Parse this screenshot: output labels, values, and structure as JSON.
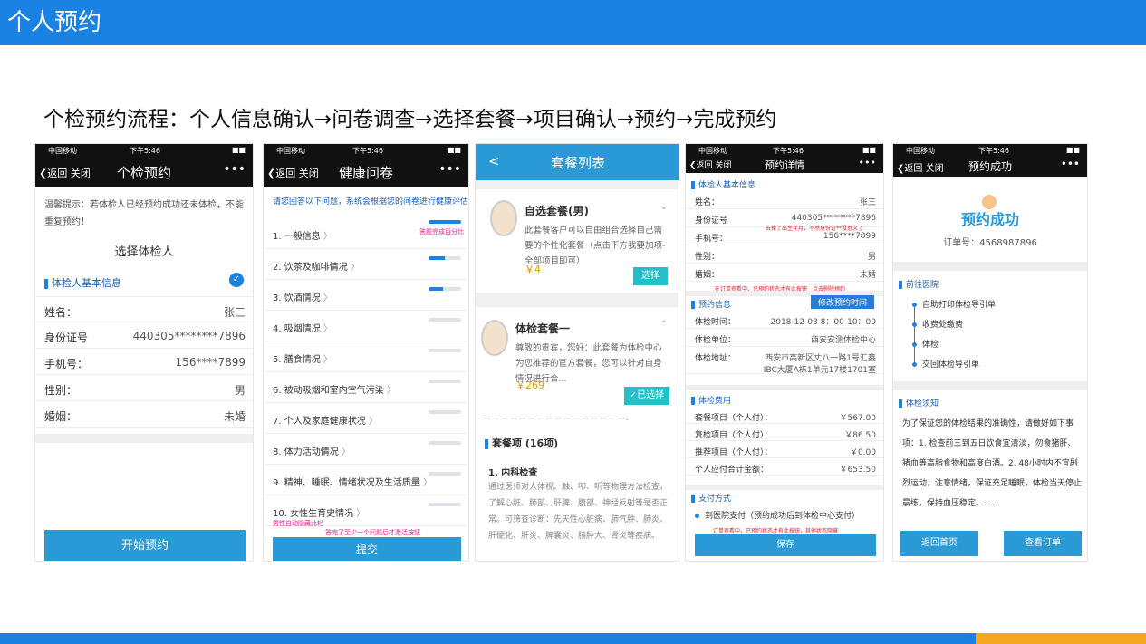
{
  "header": {
    "title": "个人预约"
  },
  "subtitle": "个检预约流程：个人信息确认→问卷调查→选择套餐→项目确认→预约→完成预约",
  "status": {
    "carrier": "中国移动",
    "time": "下午5:46",
    "battery": "■■"
  },
  "nav": {
    "back": "返回",
    "close": "关闭",
    "more": "•••"
  },
  "s1": {
    "title": "个检预约",
    "notice": "温馨提示：若体检人已经预约成功还未体检，不能重复预约！",
    "select": "选择体检人",
    "section": "体检人基本信息",
    "rows": [
      {
        "l": "姓名：",
        "r": "张三"
      },
      {
        "l": "身份证号",
        "r": "440305********7896"
      },
      {
        "l": "手机号：",
        "r": "156****7899"
      },
      {
        "l": "性别：",
        "r": "男"
      },
      {
        "l": "婚姻：",
        "r": "未婚"
      }
    ],
    "button": "开始预约"
  },
  "s2": {
    "title": "健康问卷",
    "hint": "请您回答以下问题，系统会根据您的问卷进行健康评估",
    "progress_note": "答题完成百分比",
    "items": [
      "1. 一般信息",
      "2. 饮茶及咖啡情况",
      "3. 饮酒情况",
      "4. 吸烟情况",
      "5. 膳食情况",
      "6. 被动吸烟和室内空气污染",
      "7. 个人及家庭健康状况",
      "8. 体力活动情况",
      "9. 精神、睡眠、情绪状况及生活质量",
      "10. 女性生育史情况"
    ],
    "progress": [
      1,
      0.5,
      0.45,
      0,
      0,
      0,
      0,
      0,
      0,
      0
    ],
    "note1": "男性自动隐藏此栏",
    "note2": "答完了至少一个问题后才激活按钮",
    "button": "提交"
  },
  "s3": {
    "title": "套餐列表",
    "back": "<",
    "pkg1": {
      "name": "自选套餐(男)",
      "desc": "此套餐客户可以自由组合选择自己需要的个性化套餐（点击下方我要加项-全部项目即可）",
      "price": "￥4",
      "btn": "选择"
    },
    "pkg2": {
      "name": "体检套餐一",
      "desc": "尊敬的贵宾，您好：此套餐为体检中心为您推荐的官方套餐，您可以针对自身情况进行合...",
      "price": "￥269",
      "btn": "✓已选择"
    },
    "dashes": "— — — — — — — — — — — — — — — — .",
    "items_title": "套餐项 (16项)",
    "item1_title": "1. 内科检查",
    "item1_desc": "通过医师对人体视、触、叩、听等物理方法检查，了解心脏、肺部、肝脾、腹部、神经反射等是否正常。可筛查诊断：先天性心脏病、肺气肿、肺炎、肝硬化、肝炎、脾囊炎、胰肿大、肾炎等疾病。"
  },
  "s4": {
    "title": "预约详情",
    "sec1": "体检人基本信息",
    "rows1": [
      {
        "l": "姓名：",
        "r": "张三"
      },
      {
        "l": "身份证号",
        "r": "440305********7896"
      },
      {
        "l": "手机号：",
        "r": "156****7899"
      },
      {
        "l": "性别：",
        "r": "男"
      },
      {
        "l": "婚姻：",
        "r": "未婚"
      }
    ],
    "note_id": "去掉了出生年月，不然身份证**没意义了",
    "note_order": "在订单查看中，已预约状态才有此按钮　点击删除预约",
    "sec2": "预约信息",
    "modify": "修改预约时间",
    "rows2": [
      {
        "l": "体检时间：",
        "r": "2018-12-03 8：00-10：00"
      },
      {
        "l": "体检单位：",
        "r": "西安安测体检中心"
      },
      {
        "l": "体检地址：",
        "r": "西安市高新区丈八一路1号汇鑫",
        "r2": "IBC大厦A栋1单元17楼1701室"
      }
    ],
    "sec3": "体检费用",
    "rows3": [
      {
        "l": "套餐项目（个人付）：",
        "r": "￥567.00"
      },
      {
        "l": "复检项目（个人付）：",
        "r": "￥86.50"
      },
      {
        "l": "推荐项目（个人付）：",
        "r": "￥0.00"
      },
      {
        "l": "个人应付合计金额：",
        "r": "￥653.50"
      }
    ],
    "sec4": "支付方式",
    "pay": "到医院支付（预约成功后到体检中心支付）",
    "note_pay": "订单查看中，已预约状态才有此按钮，其他状态隐藏",
    "button": "保存"
  },
  "s5": {
    "title": "预约成功",
    "logo": "预约成功",
    "order": "订单号：4568987896",
    "sec1": "前往医院",
    "steps": [
      "自助打印体检导引单",
      "收费处缴费",
      "体检",
      "交回体检导引单"
    ],
    "sec2": "体检须知",
    "notice": "为了保证您的体检结果的准确性，请做好如下事项：1. 检查前三到五日饮食宜清淡，勿食猪肝、猪血等高脂食物和高度白酒。2. 48小时内不宜剧烈运动，注意情绪，保证充足睡眠，体检当天停止晨练，保持血压稳定。……",
    "btn_home": "返回首页",
    "btn_order": "查看订单"
  },
  "colors": {
    "primary": "#1a82e2",
    "accent": "#f5a623",
    "button": "#2a9ad6"
  }
}
